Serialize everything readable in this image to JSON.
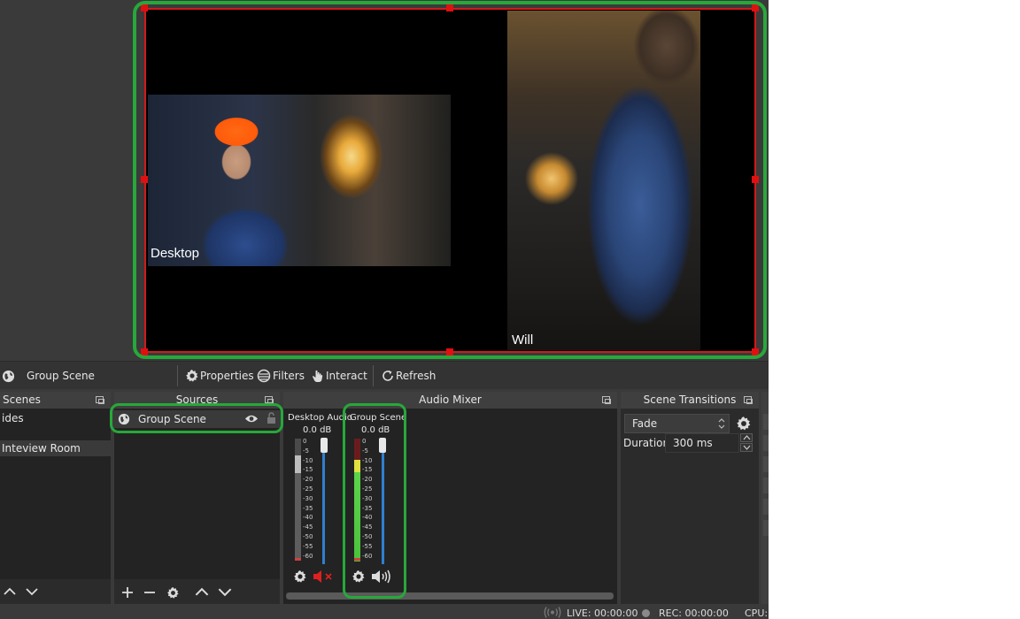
{
  "preview": {
    "sources": [
      {
        "name": "Desktop"
      },
      {
        "name": "Will"
      }
    ]
  },
  "source_toolbar": {
    "current_source": "Group Scene",
    "properties_label": "Properties",
    "filters_label": "Filters",
    "interact_label": "Interact",
    "refresh_label": "Refresh"
  },
  "docks": {
    "scenes": {
      "title": "Scenes",
      "items": [
        "ides",
        "Inteview Room"
      ],
      "selected_index": 1
    },
    "sources": {
      "title": "Sources",
      "items": [
        {
          "name": "Group Scene",
          "visible": true,
          "locked": false
        }
      ]
    },
    "audio_mixer": {
      "title": "Audio Mixer",
      "tick_labels": [
        "0",
        "-5",
        "-10",
        "-15",
        "-20",
        "-25",
        "-30",
        "-35",
        "-40",
        "-45",
        "-50",
        "-55",
        "-60"
      ],
      "channels": [
        {
          "name": "Desktop Audio",
          "db": "0.0 dB",
          "muted": true
        },
        {
          "name": "Group Scene",
          "db": "0.0 dB",
          "muted": false
        }
      ]
    },
    "scene_transitions": {
      "title": "Scene Transitions",
      "transition": "Fade",
      "duration_label": "Duration",
      "duration_value": "300 ms"
    }
  },
  "statusbar": {
    "live": "LIVE: 00:00:00",
    "rec": "REC: 00:00:00",
    "cpu": "CPU:"
  },
  "colors": {
    "highlight": "#27a83a",
    "bounding_box": "#d11a1a",
    "fader": "#2f7fd0",
    "muted_icon": "#e02020"
  },
  "icons": [
    "globe-icon",
    "gear-icon",
    "filters-icon",
    "hand-icon",
    "refresh-icon",
    "eye-icon",
    "lock-icon",
    "plus-icon",
    "minus-icon",
    "chevron-up-icon",
    "chevron-down-icon",
    "speaker-icon",
    "speaker-muted-icon",
    "broadcast-icon",
    "record-dot-icon"
  ]
}
